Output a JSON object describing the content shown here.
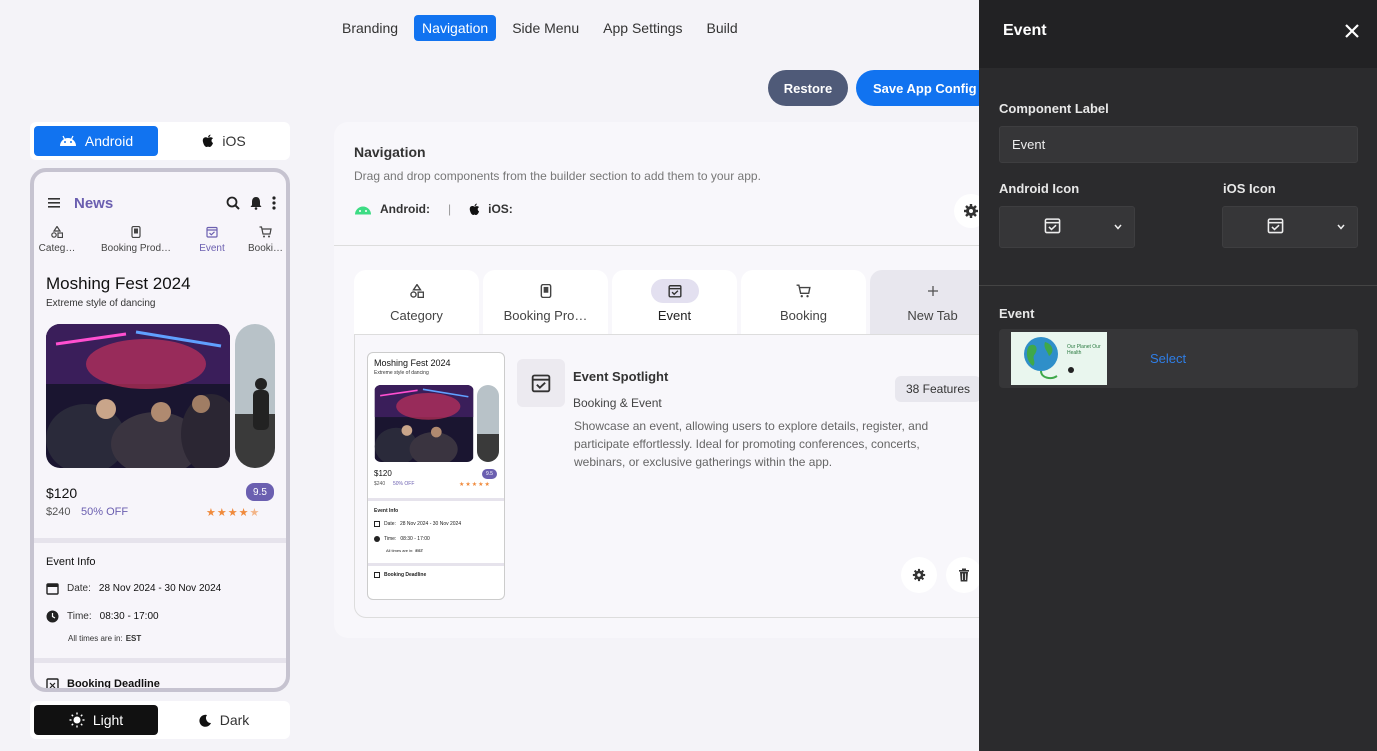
{
  "top_nav": {
    "items": [
      {
        "label": "Branding",
        "active": false
      },
      {
        "label": "Navigation",
        "active": true
      },
      {
        "label": "Side Menu",
        "active": false
      },
      {
        "label": "App Settings",
        "active": false
      },
      {
        "label": "Build",
        "active": false
      }
    ]
  },
  "actions": {
    "restore": "Restore",
    "save": "Save App Config"
  },
  "platform_toggle": {
    "android": "Android",
    "ios": "iOS",
    "selected": "Android"
  },
  "theme_toggle": {
    "light": "Light",
    "dark": "Dark",
    "selected": "Light"
  },
  "phone": {
    "header_title": "News",
    "tabs": [
      {
        "label": "Categ…",
        "icon": "category-icon"
      },
      {
        "label": "Booking Prod…",
        "icon": "phone-icon"
      },
      {
        "label": "Event",
        "icon": "calendar-check-icon"
      },
      {
        "label": "Booki…",
        "icon": "cart-icon"
      }
    ],
    "event_title": "Moshing Fest 2024",
    "event_subtitle": "Extreme style of dancing",
    "price": "$120",
    "old_price": "$240",
    "discount": "50% OFF",
    "rating": "9.5",
    "stars": "4.5 of 5",
    "event_info_title": "Event Info",
    "date_label": "Date:",
    "date_value": "28 Nov 2024 - 30 Nov 2024",
    "time_label": "Time:",
    "time_value": "08:30 - 17:00",
    "timezone_prefix": "All times are in:",
    "timezone": "EST",
    "booking_deadline": "Booking Deadline"
  },
  "navigation_panel": {
    "title": "Navigation",
    "description": "Drag and drop components from the builder section to add them to your app.",
    "android_label": "Android:",
    "ios_label": "iOS:",
    "tabs": [
      {
        "label": "Category",
        "icon": "category-icon"
      },
      {
        "label": "Booking Pro…",
        "icon": "phone-icon"
      },
      {
        "label": "Event",
        "icon": "calendar-check-icon",
        "active": true
      },
      {
        "label": "Booking",
        "icon": "cart-icon"
      },
      {
        "label": "New Tab",
        "icon": "plus-icon"
      }
    ],
    "component": {
      "title": "Event Spotlight",
      "category": "Booking & Event",
      "features": "38 Features",
      "description": "Showcase an event, allowing users to explore details, register, and participate effortlessly. Ideal for promoting conferences, concerts, webinars, or exclusive gatherings within the app."
    },
    "mini_preview": {
      "title": "Moshing Fest 2024",
      "subtitle": "Extreme style of dancing",
      "price": "$120",
      "old_price": "$240",
      "discount": "50% OFF",
      "rating": "9.5",
      "event_info": "Event Info",
      "date_label": "Date:",
      "date_value": "28 Nov 2024 - 30 Nov 2024",
      "time_label": "Time:",
      "time_value": "08:30 - 17:00",
      "tz_prefix": "All times are in:",
      "tz": "EST",
      "deadline": "Booking Deadline"
    }
  },
  "drawer": {
    "title": "Event",
    "component_label_title": "Component Label",
    "component_label_value": "Event",
    "android_icon_label": "Android Icon",
    "ios_icon_label": "iOS Icon",
    "event_section_label": "Event",
    "thumbnail_text": "Our Planet Our Health",
    "select_label": "Select"
  },
  "colors": {
    "accent_blue": "#1173f0",
    "purple": "#6b5fb0",
    "drawer_bg": "#2b2b2d",
    "android_green": "#3ddc84",
    "star_orange": "#f08a3c"
  }
}
